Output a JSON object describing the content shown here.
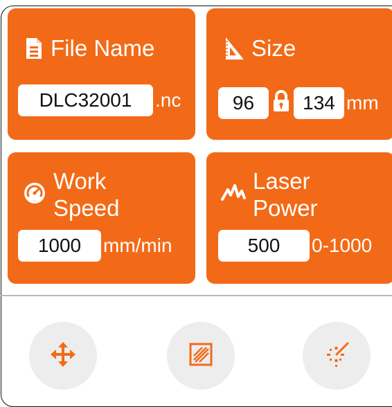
{
  "cards": {
    "file_name": {
      "title": "File Name",
      "icon": "document-icon",
      "value": "DLC32001",
      "suffix": ".nc"
    },
    "size": {
      "title": "Size",
      "icon": "ruler-triangle-icon",
      "width": "96",
      "height": "134",
      "lock_icon": "lock-icon",
      "unit": "mm"
    },
    "work_speed": {
      "title_line1": "Work",
      "title_line2": "Speed",
      "icon": "speedometer-icon",
      "value": "1000",
      "unit": "mm/min"
    },
    "laser_power": {
      "title_line1": "Laser",
      "title_line2": "Power",
      "icon": "waveform-icon",
      "value": "500",
      "range": "0-1000"
    }
  },
  "bottom_buttons": [
    {
      "icon": "move-arrows-icon"
    },
    {
      "icon": "frame-fill-icon"
    },
    {
      "icon": "laser-spark-icon"
    }
  ],
  "colors": {
    "accent": "#f26a17",
    "button_bg": "#ededed",
    "field_bg": "#ffffff",
    "divider": "#b9b9b9"
  }
}
